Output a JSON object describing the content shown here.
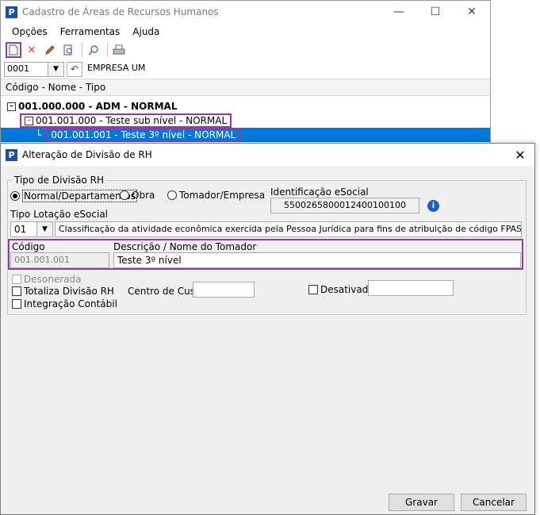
{
  "back_window": {
    "title": "Cadastro de Áreas de Recursos Humanos",
    "menu": [
      "Opções",
      "Ferramentas",
      "Ajuda"
    ],
    "company_code": "0001",
    "company_name": "EMPRESA UM",
    "column_header": "Código - Nome - Tipo",
    "tree": {
      "root": "001.000.000 - ADM - NORMAL",
      "child": "001.001.000 - Teste sub nível - NORMAL",
      "grandchild": "001.001.001 - Teste 3º nível - NORMAL"
    }
  },
  "dialog": {
    "title": "Alteração de Divisão de RH",
    "group_label": "Tipo de Divisão RH",
    "radios": {
      "normal": "Normal/Departamentos",
      "obra": "Obra",
      "tomador": "Tomador/Empresa",
      "selected": "normal"
    },
    "esocial_label": "Identificação eSocial",
    "esocial_value": "5500265800012400100100",
    "lotacao_label": "Tipo Lotação eSocial",
    "lotacao_code": "01",
    "lotacao_desc": "Classificação da atividade econômica exercida pela Pessoa Jurídica para fins de atribuição de código FPAS, inclusive obras",
    "codigo_label": "Código",
    "codigo_value": "001.001.001",
    "descricao_label": "Descrição / Nome do Tomador",
    "descricao_value": "Teste 3º nível",
    "desonerada_label": "Desonerada",
    "totaliza_label": "Totaliza Divisão RH",
    "integracao_label": "Integração Contábil",
    "centro_label": "Centro de Custo",
    "centro_value": "",
    "desativado_label": "Desativado",
    "desativado_value": "",
    "save_label": "Gravar",
    "cancel_label": "Cancelar"
  },
  "colors": {
    "accent": "#0078d7",
    "highlight": "#8e3f9c",
    "brand": "#1f4e9c"
  }
}
